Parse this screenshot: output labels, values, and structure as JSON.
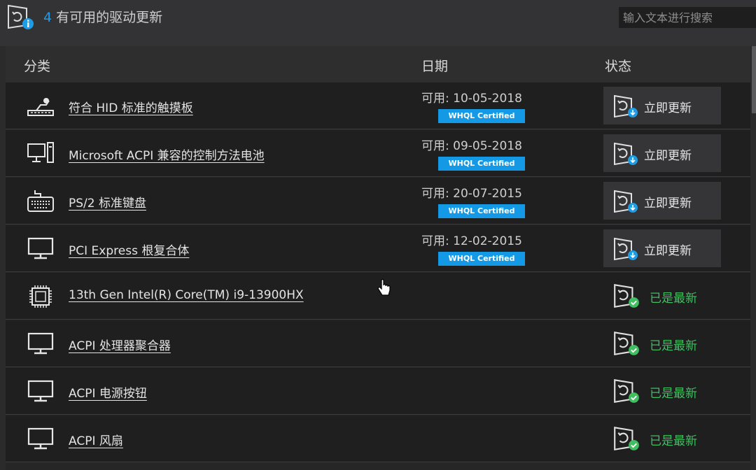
{
  "header": {
    "count": "4",
    "title": "有可用的驱动更新",
    "search_placeholder": "输入文本进行搜索"
  },
  "columns": {
    "category": "分类",
    "date": "日期",
    "status": "状态"
  },
  "updates": [
    {
      "name": "符合 HID 标准的触摸板",
      "icon": "touchpad-icon",
      "date": "可用: 10-05-2018",
      "badge": "WHQL Certified",
      "action": "立即更新"
    },
    {
      "name": "Microsoft ACPI 兼容的控制方法电池",
      "icon": "computer-tower-icon",
      "date": "可用: 09-05-2018",
      "badge": "WHQL Certified",
      "action": "立即更新"
    },
    {
      "name": "PS/2 标准键盘",
      "icon": "keyboard-icon",
      "date": "可用: 20-07-2015",
      "badge": "WHQL Certified",
      "action": "立即更新"
    },
    {
      "name": "PCI Express 根复合体",
      "icon": "monitor-icon",
      "date": "可用: 12-02-2015",
      "badge": "WHQL Certified",
      "action": "立即更新"
    }
  ],
  "uptodate": [
    {
      "name": "13th Gen Intel(R) Core(TM) i9-13900HX",
      "icon": "cpu-chip-icon",
      "status": "已是最新"
    },
    {
      "name": "ACPI 处理器聚合器",
      "icon": "monitor-icon",
      "status": "已是最新"
    },
    {
      "name": "ACPI 电源按钮",
      "icon": "monitor-icon",
      "status": "已是最新"
    },
    {
      "name": "ACPI 风扇",
      "icon": "monitor-icon",
      "status": "已是最新"
    }
  ],
  "colors": {
    "accent": "#1e9ce6",
    "badge": "#1499e6",
    "ok": "#3fbf5f",
    "background": "#2b2b2c"
  }
}
